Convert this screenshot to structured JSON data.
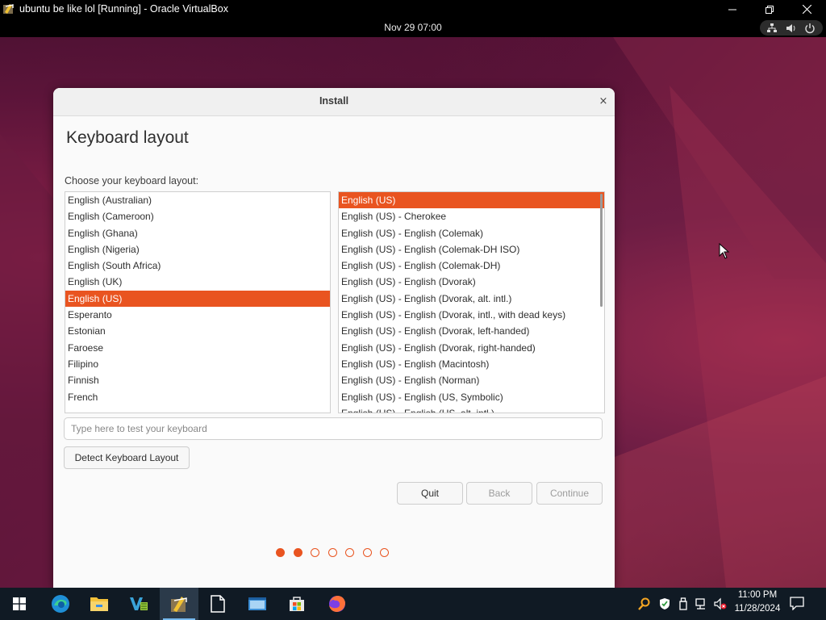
{
  "host_window": {
    "title": "ubuntu be like lol [Running] - Oracle VirtualBox",
    "controls": {
      "minimize_icon": "minimize-icon",
      "maximize_icon": "restore-icon",
      "close_icon": "close-icon"
    }
  },
  "top_panel": {
    "clock": "Nov 29  07:00",
    "status_icons": [
      "network-wired-icon",
      "volume-icon",
      "power-icon"
    ]
  },
  "dialog": {
    "title": "Install",
    "close_glyph": "×",
    "heading": "Keyboard layout",
    "choose_label": "Choose your keyboard layout:",
    "layouts": [
      {
        "label": "English (Australian)",
        "selected": false
      },
      {
        "label": "English (Cameroon)",
        "selected": false
      },
      {
        "label": "English (Ghana)",
        "selected": false
      },
      {
        "label": "English (Nigeria)",
        "selected": false
      },
      {
        "label": "English (South Africa)",
        "selected": false
      },
      {
        "label": "English (UK)",
        "selected": false
      },
      {
        "label": "English (US)",
        "selected": true
      },
      {
        "label": "Esperanto",
        "selected": false
      },
      {
        "label": "Estonian",
        "selected": false
      },
      {
        "label": "Faroese",
        "selected": false
      },
      {
        "label": "Filipino",
        "selected": false
      },
      {
        "label": "Finnish",
        "selected": false
      },
      {
        "label": "French",
        "selected": false
      }
    ],
    "variants": [
      {
        "label": "English (US)",
        "selected": true
      },
      {
        "label": "English (US) - Cherokee",
        "selected": false
      },
      {
        "label": "English (US) - English (Colemak)",
        "selected": false
      },
      {
        "label": "English (US) - English (Colemak-DH ISO)",
        "selected": false
      },
      {
        "label": "English (US) - English (Colemak-DH)",
        "selected": false
      },
      {
        "label": "English (US) - English (Dvorak)",
        "selected": false
      },
      {
        "label": "English (US) - English (Dvorak, alt. intl.)",
        "selected": false
      },
      {
        "label": "English (US) - English (Dvorak, intl., with dead keys)",
        "selected": false
      },
      {
        "label": "English (US) - English (Dvorak, left-handed)",
        "selected": false
      },
      {
        "label": "English (US) - English (Dvorak, right-handed)",
        "selected": false
      },
      {
        "label": "English (US) - English (Macintosh)",
        "selected": false
      },
      {
        "label": "English (US) - English (Norman)",
        "selected": false
      },
      {
        "label": "English (US) - English (US, Symbolic)",
        "selected": false
      },
      {
        "label": "English (US) - English (US, alt. intl.)",
        "selected": false
      }
    ],
    "test_placeholder": "Type here to test your keyboard",
    "test_value": "",
    "detect_button": "Detect Keyboard Layout",
    "quit_button": "Quit",
    "back_button": "Back",
    "continue_button": "Continue",
    "back_enabled": false,
    "continue_enabled": false,
    "progress": {
      "total_steps": 7,
      "completed_steps": 2
    }
  },
  "taskbar": {
    "apps": [
      "windows-start-icon",
      "edge-browser-icon",
      "file-explorer-icon",
      "virtualbox-manager-icon",
      "virtualbox-vm-icon",
      "document-icon",
      "window-switcher-icon",
      "microsoft-store-icon",
      "firefox-icon"
    ],
    "active_app": "virtualbox-vm-icon",
    "tray_icons": [
      "search-magnifier-icon",
      "security-shield-icon",
      "usb-device-icon",
      "network-icon",
      "volume-muted-icon"
    ],
    "time": "11:00 PM",
    "date": "11/28/2024"
  },
  "colors": {
    "accent": "#e95420",
    "dialog_bg": "#fafafa",
    "taskbar_bg": "#101a24"
  }
}
